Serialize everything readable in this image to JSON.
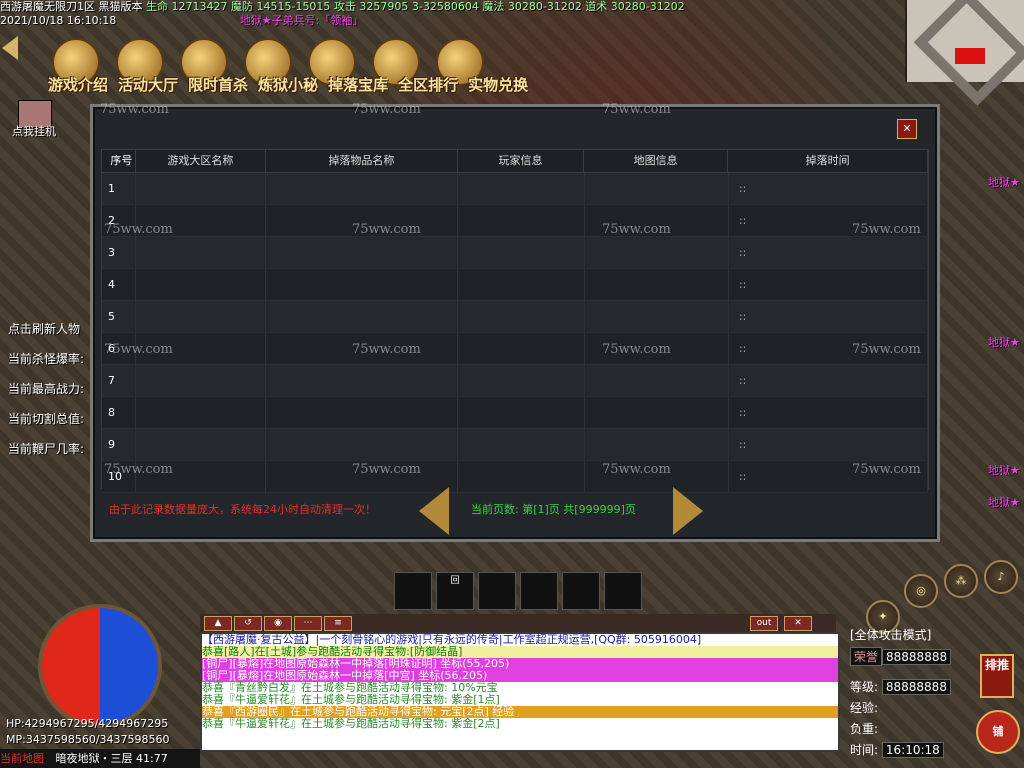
{
  "game": {
    "title": "西游屠魔无限刀1区",
    "version": "黑猫版本",
    "stats": "生命 12713427 魔防 14515-15015 攻击 3257905 3-32580604 魔法 30280-31202 道术 30280-31202",
    "datetime": "2021/10/18 16:10:18",
    "npc_title": "地狱★子弟兵号:「领袖」"
  },
  "menu": [
    "游戏介绍",
    "活动大厅",
    "限时首杀",
    "炼狱小秘",
    "掉落宝库",
    "全区排行",
    "实物兑换"
  ],
  "left": {
    "afk": "点我挂机",
    "refresh": "点击刷新人物",
    "kill_rate": "当前杀怪爆率:",
    "max_power": "当前最高战力:",
    "cut_total": "当前切割总值:",
    "corpse": "当前鞭尸几率:"
  },
  "panel": {
    "headers": [
      "序号",
      "游戏大区名称",
      "掉落物品名称",
      "玩家信息",
      "地图信息",
      "掉落时间"
    ],
    "rows": [
      {
        "no": "1",
        "time": "::"
      },
      {
        "no": "2",
        "time": "::"
      },
      {
        "no": "3",
        "time": "::"
      },
      {
        "no": "4",
        "time": "::"
      },
      {
        "no": "5",
        "time": "::"
      },
      {
        "no": "6",
        "time": "::"
      },
      {
        "no": "7",
        "time": "::"
      },
      {
        "no": "8",
        "time": "::"
      },
      {
        "no": "9",
        "time": "::"
      },
      {
        "no": "10",
        "time": "::"
      }
    ],
    "footer_note": "由于此记录数据量庞大，系统每24小时自动清理一次！",
    "page_label": "当前页数: 第[1]页  共[999999]页",
    "close": "✕",
    "watermark": "75ww.com"
  },
  "hud": {
    "hp": "HP:4294967295/4294967295",
    "mp": "MP:3437598560/3437598560",
    "map_label": "当前地图",
    "map_name": "暗夜地狱・三层 41:77",
    "attack_mode": "[全体攻击模式]",
    "score_label": "荣誉",
    "score": "88888888",
    "level_label": "等级:",
    "level": "88888888",
    "exp_label": "经验:",
    "load_label": "负重:",
    "time_label": "时间:",
    "time": "16:10:18",
    "rank": "排推",
    "shop": "铺",
    "out": "out",
    "chat_close": "✕"
  },
  "chat": [
    {
      "text": "【西游屠魔·复古公益】|一个刻骨铭心的游戏|只有永远的传奇|工作室超正规运营,[QQ群: 505916004]",
      "bg": "#ffffff",
      "fg": "#1a1aa0"
    },
    {
      "text": "恭喜[路人]在[土城]参与跑酷活动寻得宝物:[防御结晶]",
      "bg": "#f0f0a0",
      "fg": "#0a7a0a"
    },
    {
      "text": "[铜尸][暴熔]在地图原始森林一中掉落[明珠证明] 坐标(55,205)",
      "bg": "#e040e0",
      "fg": "#ffffff"
    },
    {
      "text": "[铜尸][暴熔]在地图原始森林一中掉落[中宫] 坐标(56,205)",
      "bg": "#e040e0",
      "fg": "#ffffff"
    },
    {
      "text": "恭喜『青丝黔白发』在土城参与跑酷活动寻得宝物: 10%元宝",
      "bg": "#ffffff",
      "fg": "#2a8a2a"
    },
    {
      "text": "恭喜『牛逼爱轩花』在土城参与跑酷活动寻得宝物: 紫金[1点]",
      "bg": "#ffffff",
      "fg": "#2a8a2a"
    },
    {
      "text": "恭喜『西游圈民』在土城参与跑酷活动寻得宝物: 元宝[2点] 经验",
      "bg": "#e0a020",
      "fg": "#ffffff"
    },
    {
      "text": "恭喜『牛逼爱轩花』在土城参与跑酷活动寻得宝物: 紫金[2点]",
      "bg": "#ffffff",
      "fg": "#2a8a2a"
    }
  ],
  "skills": [
    "",
    "回",
    "",
    "",
    "",
    ""
  ]
}
